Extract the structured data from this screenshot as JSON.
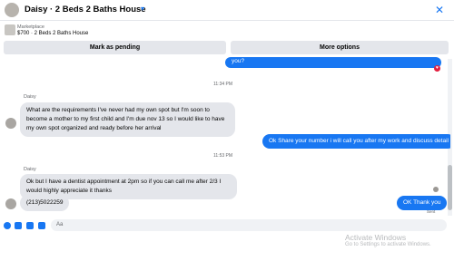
{
  "header": {
    "title": "Daisy · 2 Beds 2 Baths House",
    "chevron_icon": "chevron-down-icon",
    "close_icon": "close-icon"
  },
  "listing": {
    "source": "Marketplace",
    "name": "$700 · 2 Beds 2 Baths House"
  },
  "actions": {
    "mark_pending": "Mark as pending",
    "more_options": "More options"
  },
  "messages": [
    {
      "type": "out",
      "text": "you?"
    },
    {
      "type": "time",
      "text": "11:34 PM"
    },
    {
      "type": "sender",
      "text": "Daisy"
    },
    {
      "type": "in",
      "text": "What are the requirements I've never had my own spot but I'm soon to become a mother to my first child and I'm due nov 13 so I would like to have my own spot organized and ready before her arrival"
    },
    {
      "type": "out",
      "text": "Ok Share your number i will call you after my work and discuss detail"
    },
    {
      "type": "time",
      "text": "11:53 PM"
    },
    {
      "type": "sender",
      "text": "Daisy"
    },
    {
      "type": "in",
      "text": "Ok but I have a dentist appointment at 2pm so if you can call me after 2/3 I would highly appreciate it thanks"
    },
    {
      "type": "in",
      "text": "(213)5022259"
    },
    {
      "type": "out",
      "text": "OK Thank you"
    }
  ],
  "status": {
    "sent": "Sent"
  },
  "watermark": {
    "line1": "Activate Windows",
    "line2": "Go to Settings to activate Windows."
  },
  "composer": {
    "input_value": "Aa",
    "icons": [
      "plus-icon",
      "sticker-icon",
      "gallery-icon",
      "gif-icon"
    ]
  },
  "colors": {
    "accent": "#1877f2",
    "bubble_in": "#e4e6eb",
    "heart": "#e41e3f"
  }
}
